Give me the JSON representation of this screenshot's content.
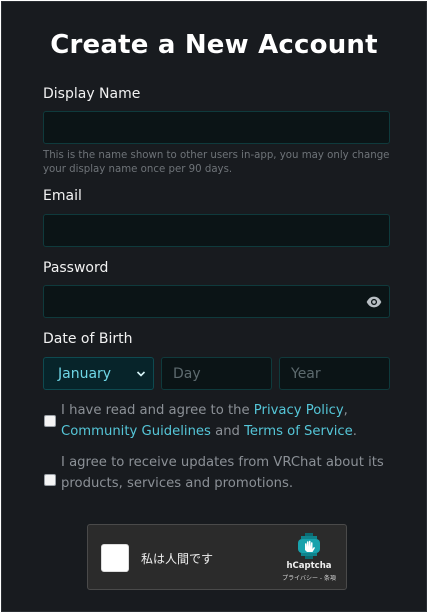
{
  "form": {
    "title": "Create a New Account",
    "display_name": {
      "label": "Display Name",
      "value": "",
      "hint": "This is the name shown to other users in-app, you may only change your display name once per 90 days."
    },
    "email": {
      "label": "Email",
      "value": ""
    },
    "password": {
      "label": "Password",
      "value": "",
      "icon": "eye-icon"
    },
    "dob": {
      "label": "Date of Birth",
      "month": "January",
      "day_placeholder": "Day",
      "year_placeholder": "Year"
    },
    "terms": {
      "prefix": "I have read and agree to the ",
      "privacy": "Privacy Policy",
      "comma": ",",
      "guidelines": "Community Guidelines",
      "and": " and ",
      "tos": "Terms of Service",
      "end": ".",
      "checked": false
    },
    "updates": {
      "text": "I agree to receive updates from VRChat about its products, services and promotions.",
      "checked": false
    },
    "captcha": {
      "label": "私は人間です",
      "brand": "hCaptcha",
      "links": "プライバシー - 条項"
    }
  },
  "colors": {
    "panel": "#181b1f",
    "accent": "#55c6d8",
    "input_bg": "#0b1416"
  }
}
